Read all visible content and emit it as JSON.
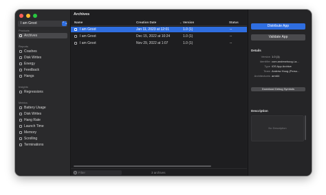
{
  "app_selector": {
    "value": "I am Groot",
    "chevron": "⌃⌄"
  },
  "sidebar": {
    "products_header": "Products",
    "archives_label": "Archives",
    "reports_header": "Reports",
    "reports": [
      {
        "label": "Crashes",
        "icon": "crash-icon"
      },
      {
        "label": "Disk Writes",
        "icon": "disk-icon"
      },
      {
        "label": "Energy",
        "icon": "energy-icon"
      },
      {
        "label": "Feedback",
        "icon": "feedback-icon"
      },
      {
        "label": "Hangs",
        "icon": "hang-icon"
      }
    ],
    "insights_header": "Insights",
    "insights": [
      {
        "label": "Regressions",
        "icon": "regression-icon"
      }
    ],
    "metrics_header": "Metrics",
    "metrics": [
      {
        "label": "Battery Usage",
        "icon": "battery-icon"
      },
      {
        "label": "Disk Writes",
        "icon": "disk-icon"
      },
      {
        "label": "Hang Rate",
        "icon": "hang-rate-icon"
      },
      {
        "label": "Launch Time",
        "icon": "launch-icon"
      },
      {
        "label": "Memory",
        "icon": "memory-icon"
      },
      {
        "label": "Scrolling",
        "icon": "scroll-icon"
      },
      {
        "label": "Terminations",
        "icon": "termination-icon"
      }
    ]
  },
  "archives": {
    "title": "Archives",
    "columns": {
      "name": "Name",
      "date": "Creation Date",
      "version": "Version",
      "status": "Status"
    },
    "rows": [
      {
        "name": "I am Groot",
        "date": "Jan 11, 2023 at 12:01",
        "version": "1.0 (1)",
        "status": "--",
        "selected": true
      },
      {
        "name": "I am Groot",
        "date": "Dec 15, 2022 at 10:24",
        "version": "1.0 (1)",
        "status": "--",
        "selected": false
      },
      {
        "name": "I am Groot",
        "date": "Nov 29, 2022 at 1:07",
        "version": "1.0 (1)",
        "status": "--",
        "selected": false
      }
    ],
    "filter_placeholder": "Filter",
    "count_text": "3 archives"
  },
  "inspector": {
    "distribute_label": "Distribute App",
    "validate_label": "Validate App",
    "details_header": "Details",
    "details": [
      {
        "key": "Version",
        "value": "1.0 (1)"
      },
      {
        "key": "Identifier",
        "value": "com.andrewhoog.i-a..."
      },
      {
        "key": "Type",
        "value": "iOS App Archive"
      },
      {
        "key": "Team",
        "value": "Andrew Hoog (Perso..."
      },
      {
        "key": "Architectures",
        "value": "arm64"
      }
    ],
    "download_symbols_label": "Download Debug Symbols",
    "description_header": "Description",
    "description_placeholder": "No Description"
  },
  "colors": {
    "accent": "#2f6ee0",
    "window_bg": "#1f1f21"
  }
}
